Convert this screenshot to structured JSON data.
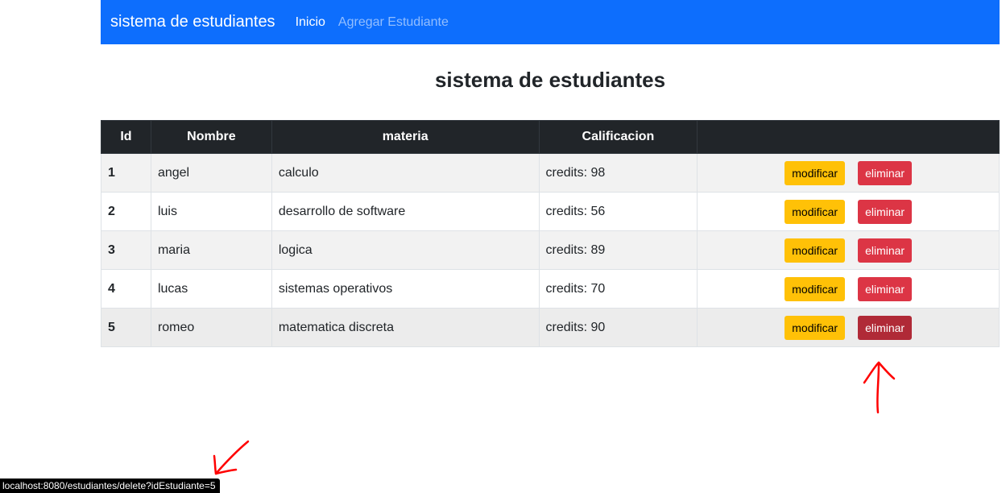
{
  "navbar": {
    "brand": "sistema de estudiantes",
    "links": [
      {
        "label": "Inicio",
        "active": true
      },
      {
        "label": "Agregar Estudiante",
        "active": false
      }
    ],
    "color": "#0d6efd"
  },
  "main": {
    "title": "sistema de estudiantes",
    "table": {
      "headers": [
        "Id",
        "Nombre",
        "materia",
        "Calificacion",
        ""
      ],
      "rows": [
        {
          "id": "1",
          "nombre": "angel",
          "materia": "calculo",
          "calificacion": "credits: 98"
        },
        {
          "id": "2",
          "nombre": "luis",
          "materia": "desarrollo de software",
          "calificacion": "credits: 56"
        },
        {
          "id": "3",
          "nombre": "maria",
          "materia": "logica",
          "calificacion": "credits: 89"
        },
        {
          "id": "4",
          "nombre": "lucas",
          "materia": "sistemas operativos",
          "calificacion": "credits: 70"
        },
        {
          "id": "5",
          "nombre": "romeo",
          "materia": "matematica discreta",
          "calificacion": "credits: 90"
        }
      ],
      "buttons": {
        "modify_label": "modificar",
        "delete_label": "eliminar"
      },
      "hovered_row": 5
    }
  },
  "status_bar": {
    "url": "localhost:8080/estudiantes/delete?idEstudiante=5"
  },
  "annotations": {
    "arrow_color": "#ff0000",
    "icons": [
      "red-arrow-up-icon",
      "red-arrow-down-left-icon"
    ]
  },
  "colors": {
    "table_header": "#212529",
    "warning": "#ffc107",
    "danger": "#dc3545",
    "danger_hover": "#b02a37"
  }
}
